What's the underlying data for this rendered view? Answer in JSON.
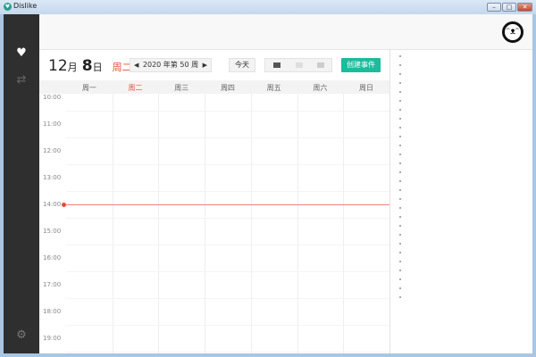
{
  "window": {
    "title": "Dislike",
    "minimize": "–",
    "maximize": "□",
    "close": "✕"
  },
  "sidebar": {
    "items": [
      {
        "icon": "heart-icon"
      },
      {
        "icon": "sync-icon"
      }
    ],
    "settings_icon": "gear-icon"
  },
  "header": {
    "avatar": "panda-avatar"
  },
  "calendar": {
    "month": "12",
    "month_unit": "月",
    "day": "8",
    "day_unit": "日",
    "weekday": "周二",
    "week_label": "2020 年第 50 周",
    "today_button": "今天",
    "create_button": "创建事件",
    "accent_color": "#1abc9c",
    "today_color": "#e74c3c",
    "days": [
      "周一",
      "周二",
      "周三",
      "周四",
      "周五",
      "周六",
      "周日"
    ],
    "current_day_index": 1,
    "hours": [
      "10:00",
      "11:00",
      "12:00",
      "13:00",
      "14:00",
      "15:00",
      "16:00",
      "17:00",
      "18:00",
      "19:00"
    ],
    "now_time": "14:00"
  }
}
